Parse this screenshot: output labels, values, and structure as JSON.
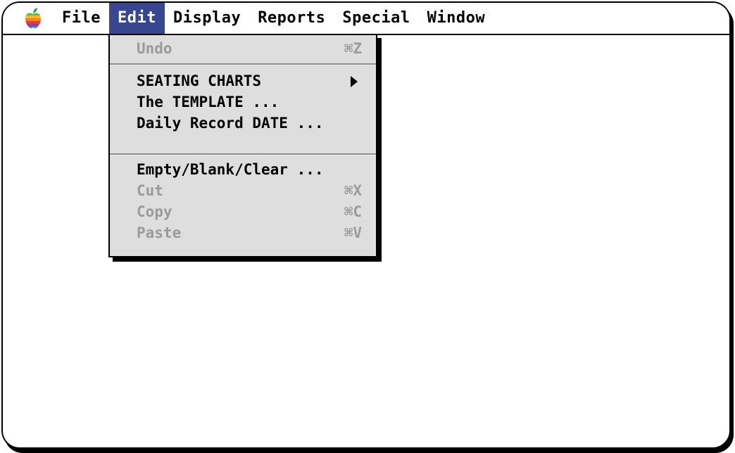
{
  "menubar": {
    "apple_icon": "apple-rainbow-icon",
    "menus": [
      {
        "label": "File"
      },
      {
        "label": "Edit"
      },
      {
        "label": "Display"
      },
      {
        "label": "Reports"
      },
      {
        "label": "Special"
      },
      {
        "label": "Window"
      }
    ],
    "active_menu": "Edit",
    "active_color": "#38458f"
  },
  "edit_menu": {
    "undo": {
      "label": "Undo",
      "shortcut": "⌘Z",
      "enabled": false
    },
    "seating_charts": {
      "label": "SEATING CHARTS",
      "submenu": true,
      "enabled": true
    },
    "template": {
      "label": "The TEMPLATE ...",
      "enabled": true
    },
    "daily_record_date": {
      "label": "Daily Record DATE ...",
      "enabled": true
    },
    "empty_blank_clear": {
      "label": "Empty/Blank/Clear ...",
      "enabled": true
    },
    "cut": {
      "label": "Cut",
      "shortcut": "⌘X",
      "enabled": false
    },
    "copy": {
      "label": "Copy",
      "shortcut": "⌘C",
      "enabled": false
    },
    "paste": {
      "label": "Paste",
      "shortcut": "⌘V",
      "enabled": false
    }
  }
}
